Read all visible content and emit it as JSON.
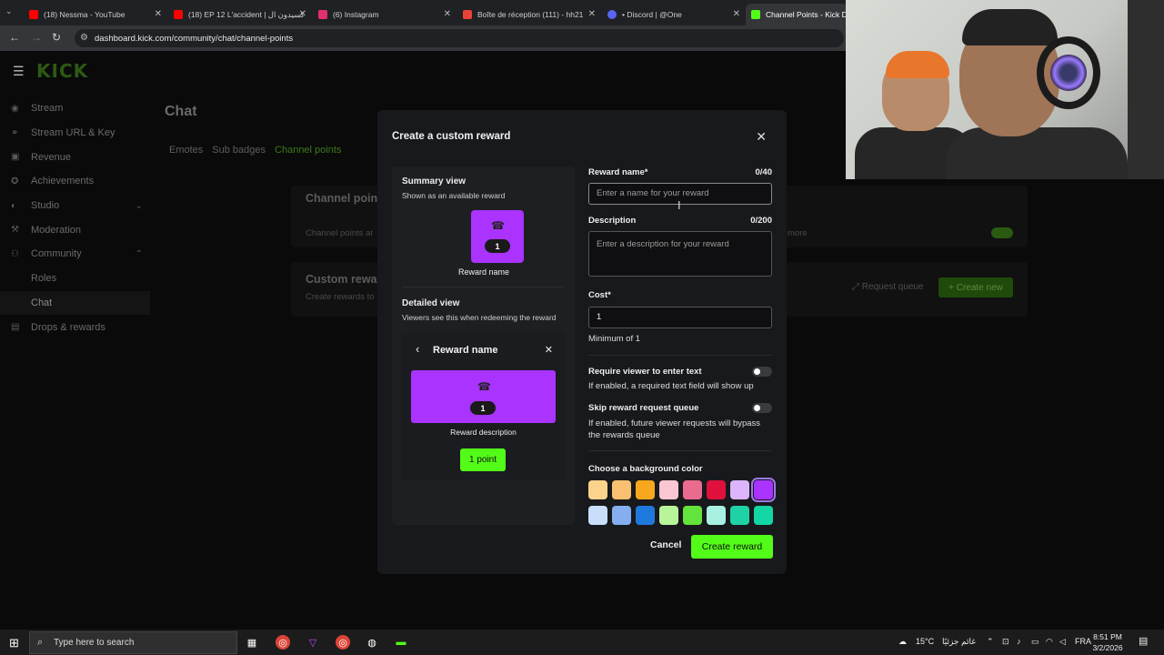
{
  "browser": {
    "tabs": [
      {
        "title": "(18) Nessma - YouTube",
        "color": "#ff0000"
      },
      {
        "title": "(18) EP 12 L'accident | كسيدون ال",
        "color": "#ff0000"
      },
      {
        "title": "(6) Instagram",
        "color": "#e1306c"
      },
      {
        "title": "Boîte de réception (111) - hh21",
        "color": "#ea4335"
      },
      {
        "title": "• Discord | @One",
        "color": "#5865f2"
      },
      {
        "title": "Channel Points - Kick Das",
        "color": "#53fc18"
      }
    ],
    "url": "dashboard.kick.com/community/chat/channel-points"
  },
  "app": {
    "logo": "KICK",
    "sidebar": [
      {
        "label": "Stream",
        "icon": "broadcast-icon"
      },
      {
        "label": "Stream URL & Key",
        "icon": "link-icon"
      },
      {
        "label": "Revenue",
        "icon": "money-icon"
      },
      {
        "label": "Achievements",
        "icon": "badge-icon"
      },
      {
        "label": "Studio",
        "icon": "studio-icon"
      },
      {
        "label": "Moderation",
        "icon": "hammer-icon"
      },
      {
        "label": "Community",
        "icon": "community-icon"
      },
      {
        "label": "Roles"
      },
      {
        "label": "Chat"
      },
      {
        "label": "Drops & rewards",
        "icon": "gift-icon"
      }
    ],
    "page_title": "Chat",
    "tabs": [
      "Emotes",
      "Sub badges",
      "Channel points"
    ],
    "panel1_title": "Channel point",
    "panel1_text": "Channel points ar",
    "panel1_more": "more",
    "panel2_title": "Custom rewa",
    "panel2_text": "Create rewards to",
    "request_queue": "Request queue",
    "create_new": "Create new"
  },
  "modal": {
    "title": "Create a custom reward",
    "summary_title": "Summary view",
    "summary_sub": "Shown as an available reward",
    "tile_cost": "1",
    "tile_label": "Reward name",
    "detailed_title": "Detailed view",
    "detailed_sub": "Viewers see this when redeeming the reward",
    "detail_name": "Reward name",
    "detail_cost": "1",
    "detail_desc": "Reward description",
    "detail_button": "1 point",
    "reward_name_label": "Reward name*",
    "reward_name_count": "0/40",
    "reward_name_placeholder": "Enter a name for your reward",
    "description_label": "Description",
    "description_count": "0/200",
    "description_placeholder": "Enter a description for your reward",
    "cost_label": "Cost*",
    "cost_value": "1",
    "cost_hint": "Minimum of 1",
    "require_text_label": "Require viewer to enter text",
    "require_text_hint": "If enabled, a required text field will show up",
    "skip_queue_label": "Skip reward request queue",
    "skip_queue_hint": "If enabled, future viewer requests will bypass the rewards queue",
    "color_label": "Choose a background color",
    "colors": [
      "#fcd38d",
      "#f8c070",
      "#f8a81e",
      "#f9c6d2",
      "#e96c8f",
      "#e0103c",
      "#dcb4fb",
      "#aa33ff",
      "#c8def9",
      "#84aef0",
      "#1f79dc",
      "#b8f49a",
      "#63e43c",
      "#a9f0e3",
      "#1fd2a6",
      "#12d6a3"
    ],
    "selected_color": "#aa33ff",
    "cancel": "Cancel",
    "create": "Create reward"
  },
  "taskbar": {
    "search_placeholder": "Type here to search",
    "weather": "15°C",
    "weather_text": "غائم جزئيًا",
    "lang": "FRA",
    "time": "8:51 PM",
    "date": "3/2/2026"
  }
}
